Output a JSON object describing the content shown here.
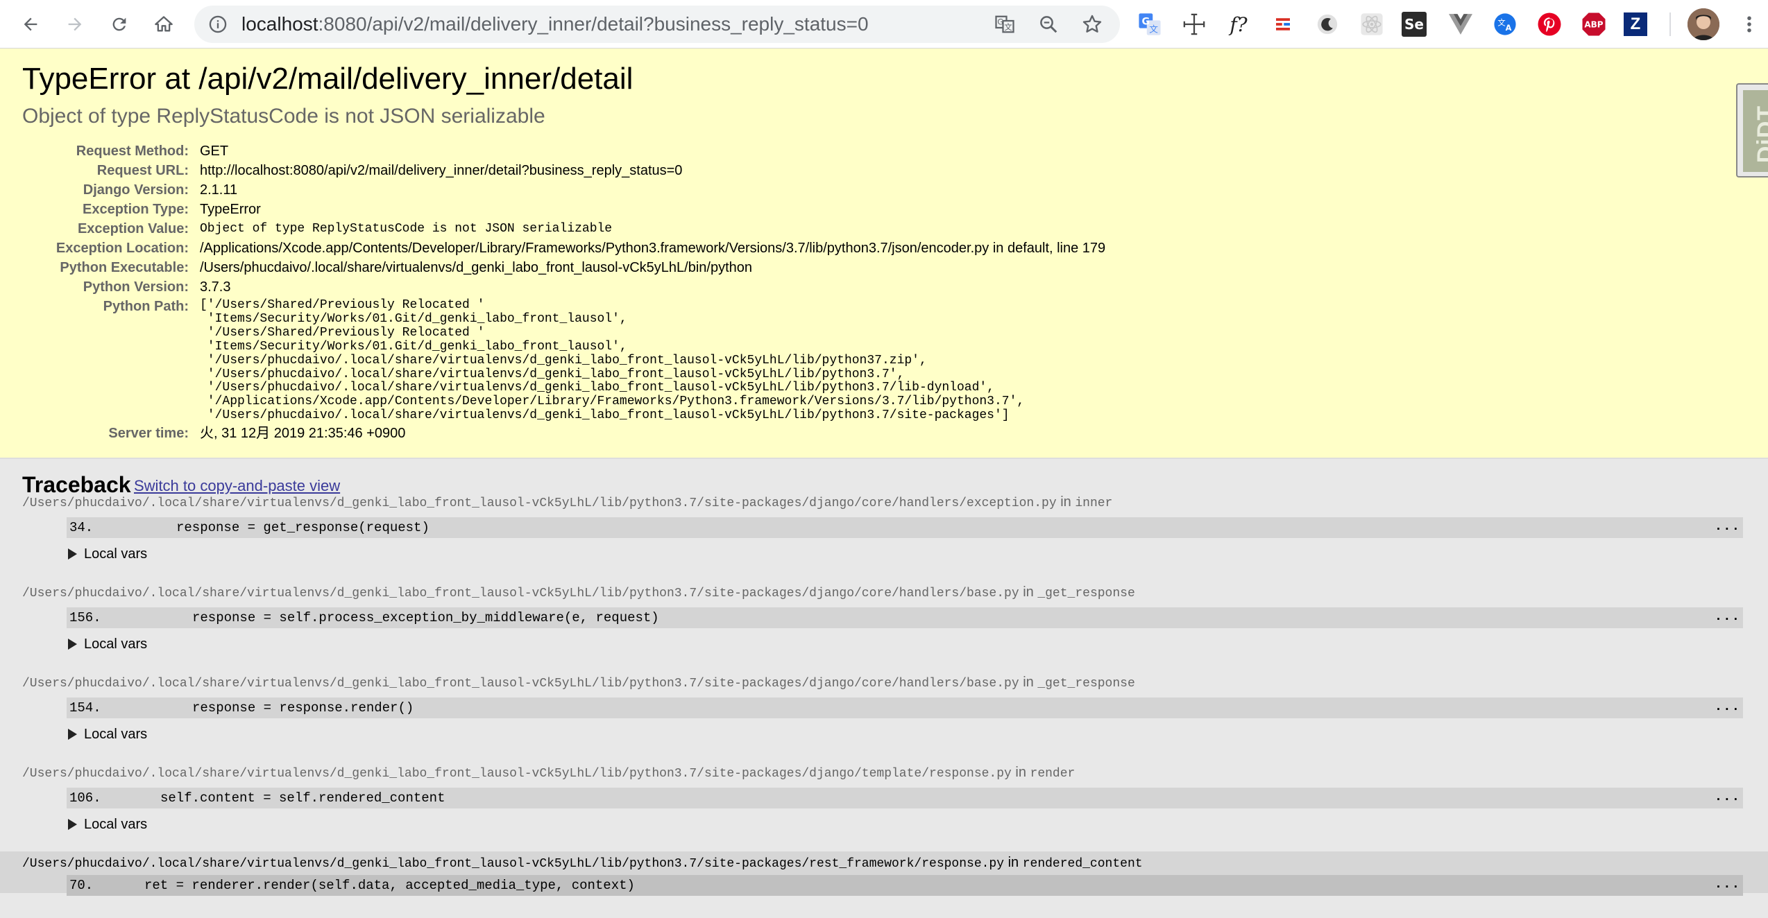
{
  "browser": {
    "url_host": "localhost",
    "url_rest": ":8080/api/v2/mail/delivery_inner/detail?business_reply_status=0",
    "extensions": [
      "google-translate-ext-icon",
      "move-cross-icon",
      "whatfont-icon",
      "layout-grid-icon",
      "dark-mode-icon",
      "react-devtools-icon",
      "selenium-ide-icon",
      "vue-devtools-icon",
      "translate-ext-icon",
      "pinterest-icon",
      "adblock-plus-icon",
      "zotero-icon",
      "profile-avatar"
    ],
    "labels": {
      "whatfont": "f?",
      "selenium": "Se",
      "abp": "ABP",
      "zotero": "Z"
    }
  },
  "error": {
    "title": "TypeError at /api/v2/mail/delivery_inner/detail",
    "subtitle": "Object of type ReplyStatusCode is not JSON serializable"
  },
  "meta": [
    {
      "label": "Request Method:",
      "value": "GET",
      "style": "plain"
    },
    {
      "label": "Request URL:",
      "value": "http://localhost:8080/api/v2/mail/delivery_inner/detail?business_reply_status=0",
      "style": "plain"
    },
    {
      "label": "Django Version:",
      "value": "2.1.11",
      "style": "plain"
    },
    {
      "label": "Exception Type:",
      "value": "TypeError",
      "style": "plain"
    },
    {
      "label": "Exception Value:",
      "value": "Object of type ReplyStatusCode is not JSON serializable",
      "style": "mono"
    },
    {
      "label": "Exception Location:",
      "value": "/Applications/Xcode.app/Contents/Developer/Library/Frameworks/Python3.framework/Versions/3.7/lib/python3.7/json/encoder.py in default, line 179",
      "style": "plain"
    },
    {
      "label": "Python Executable:",
      "value": "/Users/phucdaivo/.local/share/virtualenvs/d_genki_labo_front_lausol-vCk5yLhL/bin/python",
      "style": "plain"
    },
    {
      "label": "Python Version:",
      "value": "3.7.3",
      "style": "plain"
    },
    {
      "label": "Python Path:",
      "value": "['/Users/Shared/Previously Relocated '\n 'Items/Security/Works/01.Git/d_genki_labo_front_lausol',\n '/Users/Shared/Previously Relocated '\n 'Items/Security/Works/01.Git/d_genki_labo_front_lausol',\n '/Users/phucdaivo/.local/share/virtualenvs/d_genki_labo_front_lausol-vCk5yLhL/lib/python37.zip',\n '/Users/phucdaivo/.local/share/virtualenvs/d_genki_labo_front_lausol-vCk5yLhL/lib/python3.7',\n '/Users/phucdaivo/.local/share/virtualenvs/d_genki_labo_front_lausol-vCk5yLhL/lib/python3.7/lib-dynload',\n '/Applications/Xcode.app/Contents/Developer/Library/Frameworks/Python3.framework/Versions/3.7/lib/python3.7',\n '/Users/phucdaivo/.local/share/virtualenvs/d_genki_labo_front_lausol-vCk5yLhL/lib/python3.7/site-packages']",
      "style": "path"
    },
    {
      "label": "Server time:",
      "value": "火, 31 12月 2019 21:35:46 +0900",
      "style": "plain"
    }
  ],
  "djdt_label": "DjDT",
  "traceback": {
    "heading": "Traceback",
    "switch_link": "Switch to copy-and-paste view",
    "in_word": "in",
    "local_vars_label": "Local vars",
    "dots": "...",
    "frames": [
      {
        "file": "/Users/phucdaivo/.local/share/virtualenvs/d_genki_labo_front_lausol-vCk5yLhL/lib/python3.7/site-packages/django/core/handlers/exception.py",
        "func": "inner",
        "lineno": "34.",
        "code": "response = get_response(request)",
        "indent": 4
      },
      {
        "file": "/Users/phucdaivo/.local/share/virtualenvs/d_genki_labo_front_lausol-vCk5yLhL/lib/python3.7/site-packages/django/core/handlers/base.py",
        "func": "_get_response",
        "lineno": "156.",
        "code": "response = self.process_exception_by_middleware(e, request)",
        "indent": 5
      },
      {
        "file": "/Users/phucdaivo/.local/share/virtualenvs/d_genki_labo_front_lausol-vCk5yLhL/lib/python3.7/site-packages/django/core/handlers/base.py",
        "func": "_get_response",
        "lineno": "154.",
        "code": "response = response.render()",
        "indent": 5
      },
      {
        "file": "/Users/phucdaivo/.local/share/virtualenvs/d_genki_labo_front_lausol-vCk5yLhL/lib/python3.7/site-packages/django/template/response.py",
        "func": "render",
        "lineno": "106.",
        "code": "self.content = self.rendered_content",
        "indent": 3
      },
      {
        "file": "/Users/phucdaivo/.local/share/virtualenvs/d_genki_labo_front_lausol-vCk5yLhL/lib/python3.7/site-packages/rest_framework/response.py",
        "func": "rendered_content",
        "lineno": "70.",
        "code": "ret = renderer.render(self.data, accepted_media_type, context)",
        "indent": 2
      }
    ]
  },
  "colors": {
    "summary_bg": "#ffffc8",
    "traceback_bg": "#e8e8e8",
    "code_bg": "#d4d4d4",
    "link": "#3a3a9a"
  }
}
